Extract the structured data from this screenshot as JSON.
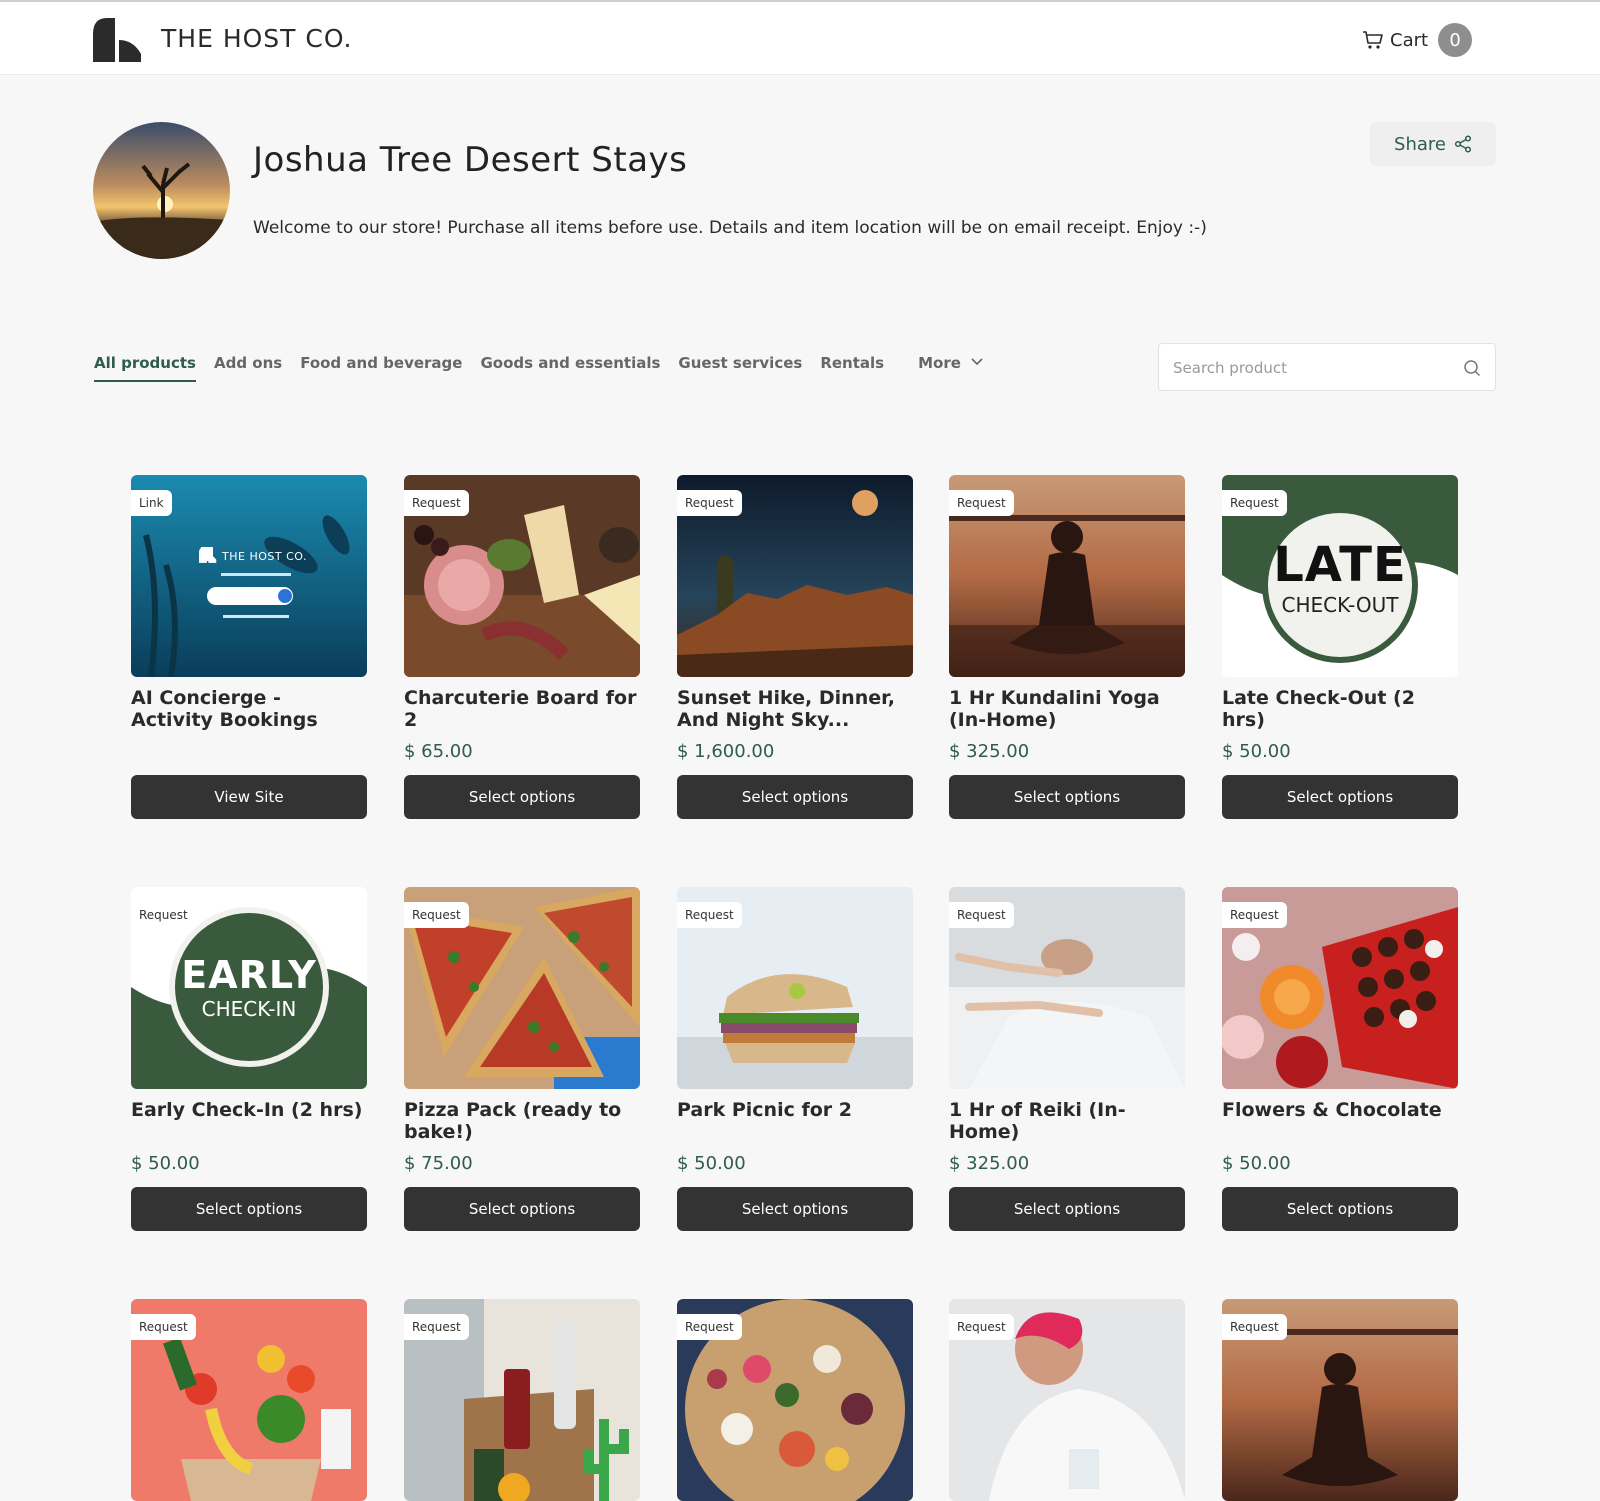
{
  "header": {
    "brand": "THE HOST CO.",
    "cart_label": "Cart",
    "cart_count": "0"
  },
  "store": {
    "title": "Joshua Tree Desert Stays",
    "description": "Welcome to our store! Purchase all items before use. Details and item location will be on email receipt. Enjoy :-)",
    "share_label": "Share"
  },
  "tabs": [
    {
      "label": "All products"
    },
    {
      "label": "Add ons"
    },
    {
      "label": "Food and beverage"
    },
    {
      "label": "Goods and essentials"
    },
    {
      "label": "Guest services"
    },
    {
      "label": "Rentals"
    },
    {
      "label": "More"
    }
  ],
  "search": {
    "placeholder": "Search product"
  },
  "products": [
    {
      "badge": "Link",
      "name": "AI Concierge - Activity Bookings",
      "price": "",
      "button": "View Site",
      "image": "ai-concierge-underwater"
    },
    {
      "badge": "Request",
      "name": "Charcuterie Board for 2",
      "price": "$ 65.00",
      "button": "Select options",
      "image": "charcuterie-board"
    },
    {
      "badge": "Request",
      "name": "Sunset Hike, Dinner, And Night Sky...",
      "price": "$ 1,600.00",
      "button": "Select options",
      "image": "desert-night-sky"
    },
    {
      "badge": "Request",
      "name": "1 Hr Kundalini Yoga (In-Home)",
      "price": "$ 325.00",
      "button": "Select options",
      "image": "yoga-silhouette"
    },
    {
      "badge": "Request",
      "name": "Late Check-Out (2 hrs)",
      "price": "$ 50.00",
      "button": "Select options",
      "image": "late-checkout-graphic",
      "graphic_big": "LATE",
      "graphic_small": "CHECK-OUT"
    },
    {
      "badge": "Request",
      "name": "Early Check-In (2 hrs)",
      "price": "$ 50.00",
      "button": "Select options",
      "image": "early-checkin-graphic",
      "graphic_big": "EARLY",
      "graphic_small": "CHECK-IN"
    },
    {
      "badge": "Request",
      "name": "Pizza Pack (ready to bake!)",
      "price": "$ 75.00",
      "button": "Select options",
      "image": "pizza"
    },
    {
      "badge": "Request",
      "name": "Park Picnic for 2",
      "price": "$ 50.00",
      "button": "Select options",
      "image": "sandwich"
    },
    {
      "badge": "Request",
      "name": "1 Hr of Reiki (In-Home)",
      "price": "$ 325.00",
      "button": "Select options",
      "image": "reiki-session"
    },
    {
      "badge": "Request",
      "name": "Flowers & Chocolate",
      "price": "$ 50.00",
      "button": "Select options",
      "image": "flowers-chocolate"
    },
    {
      "badge": "Request",
      "name": "",
      "price": "",
      "button": "",
      "image": "grocery-bag"
    },
    {
      "badge": "Request",
      "name": "",
      "price": "",
      "button": "",
      "image": "drinks-basket"
    },
    {
      "badge": "Request",
      "name": "",
      "price": "",
      "button": "",
      "image": "grazing-platter"
    },
    {
      "badge": "Request",
      "name": "",
      "price": "",
      "button": "",
      "image": "chef-cooking"
    },
    {
      "badge": "Request",
      "name": "",
      "price": "",
      "button": "",
      "image": "yoga-silhouette"
    }
  ],
  "colors": {
    "accent": "#2f5d4a",
    "button": "#333333",
    "background": "#f7f7f8"
  }
}
